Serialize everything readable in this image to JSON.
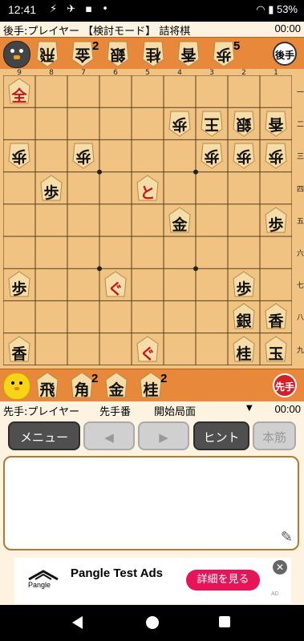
{
  "status_bar": {
    "time": "12:41",
    "battery": "53%"
  },
  "header": {
    "left": "後手:プレイヤー 【検討モード】 詰将棋",
    "right": "00:00"
  },
  "gote_hand": {
    "badge": "後手",
    "pieces": [
      {
        "char": "飛",
        "count": ""
      },
      {
        "char": "金",
        "count": "2"
      },
      {
        "char": "銀",
        "count": ""
      },
      {
        "char": "桂",
        "count": ""
      },
      {
        "char": "香",
        "count": ""
      },
      {
        "char": "歩",
        "count": "5"
      }
    ]
  },
  "board": {
    "file_labels": [
      "9",
      "8",
      "7",
      "6",
      "5",
      "4",
      "3",
      "2",
      "1"
    ],
    "rank_labels": [
      "一",
      "二",
      "三",
      "四",
      "五",
      "六",
      "七",
      "八",
      "九"
    ],
    "pieces": [
      {
        "col": 0,
        "row": 0,
        "char": "全",
        "side": "s",
        "red": true
      },
      {
        "col": 5,
        "row": 1,
        "char": "歩",
        "side": "g",
        "red": false
      },
      {
        "col": 6,
        "row": 1,
        "char": "王",
        "side": "g",
        "red": false
      },
      {
        "col": 7,
        "row": 1,
        "char": "銀",
        "side": "g",
        "red": false
      },
      {
        "col": 8,
        "row": 1,
        "char": "香",
        "side": "g",
        "red": false
      },
      {
        "col": 0,
        "row": 2,
        "char": "歩",
        "side": "g",
        "red": false
      },
      {
        "col": 2,
        "row": 2,
        "char": "歩",
        "side": "g",
        "red": false
      },
      {
        "col": 6,
        "row": 2,
        "char": "歩",
        "side": "g",
        "red": false
      },
      {
        "col": 7,
        "row": 2,
        "char": "歩",
        "side": "g",
        "red": false
      },
      {
        "col": 8,
        "row": 2,
        "char": "歩",
        "side": "g",
        "red": false
      },
      {
        "col": 1,
        "row": 3,
        "char": "歩",
        "side": "s",
        "red": false
      },
      {
        "col": 4,
        "row": 3,
        "char": "と",
        "side": "s",
        "red": true
      },
      {
        "col": 5,
        "row": 4,
        "char": "金",
        "side": "s",
        "red": false
      },
      {
        "col": 8,
        "row": 4,
        "char": "歩",
        "side": "s",
        "red": false
      },
      {
        "col": 0,
        "row": 6,
        "char": "歩",
        "side": "s",
        "red": false
      },
      {
        "col": 3,
        "row": 6,
        "char": "ぐ",
        "side": "s",
        "red": true
      },
      {
        "col": 7,
        "row": 6,
        "char": "歩",
        "side": "s",
        "red": false
      },
      {
        "col": 7,
        "row": 7,
        "char": "銀",
        "side": "s",
        "red": false
      },
      {
        "col": 8,
        "row": 7,
        "char": "香",
        "side": "s",
        "red": false
      },
      {
        "col": 0,
        "row": 8,
        "char": "香",
        "side": "s",
        "red": false
      },
      {
        "col": 4,
        "row": 8,
        "char": "ぐ",
        "side": "s",
        "red": true
      },
      {
        "col": 7,
        "row": 8,
        "char": "桂",
        "side": "s",
        "red": false
      },
      {
        "col": 8,
        "row": 8,
        "char": "玉",
        "side": "s",
        "red": false
      }
    ]
  },
  "sente_hand": {
    "badge": "先手",
    "pieces": [
      {
        "char": "飛",
        "count": ""
      },
      {
        "char": "角",
        "count": "2"
      },
      {
        "char": "金",
        "count": ""
      },
      {
        "char": "桂",
        "count": "2"
      }
    ]
  },
  "info_bar": {
    "player": "先手:プレイヤー",
    "turn": "先手番",
    "position": "開始局面",
    "time": "00:00"
  },
  "buttons": {
    "menu": "メニュー",
    "prev": "◀",
    "next": "▶",
    "hint": "ヒント",
    "main_line": "本筋"
  },
  "ad": {
    "logo": "Pangle",
    "title": "Pangle Test Ads",
    "cta": "詳細を見る",
    "ad_label": "AD"
  }
}
